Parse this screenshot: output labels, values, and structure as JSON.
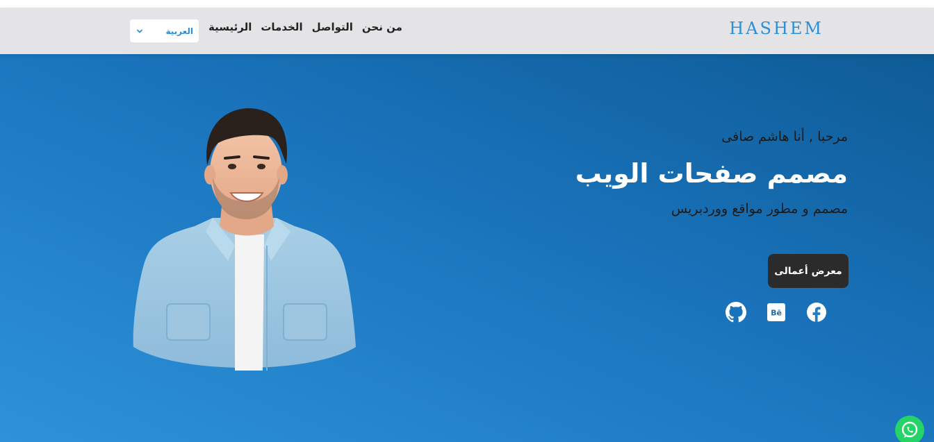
{
  "brand": {
    "name": "HASHEM",
    "color": "#2b8fd6"
  },
  "nav": {
    "items": [
      {
        "label": "الرئيسية"
      },
      {
        "label": "الخدمات"
      },
      {
        "label": "التواصل"
      },
      {
        "label": "من نحن"
      }
    ],
    "language": {
      "selected": "العربية"
    }
  },
  "hero": {
    "greeting": "مرحبا , أنا هاشم صافى",
    "headline": "مصمم صفحات الويب",
    "subtitle": "مصمم و مطور مواقع ووردبريس",
    "cta_label": "معرض أعمالى",
    "social": [
      {
        "icon": "facebook-icon"
      },
      {
        "icon": "behance-icon",
        "text": "Bē"
      },
      {
        "icon": "github-icon"
      }
    ],
    "colors": {
      "gradient_start": "#2d92da",
      "gradient_end": "#0e5b96"
    }
  },
  "floating": {
    "icon": "whatsapp-icon",
    "color": "#25d366"
  }
}
